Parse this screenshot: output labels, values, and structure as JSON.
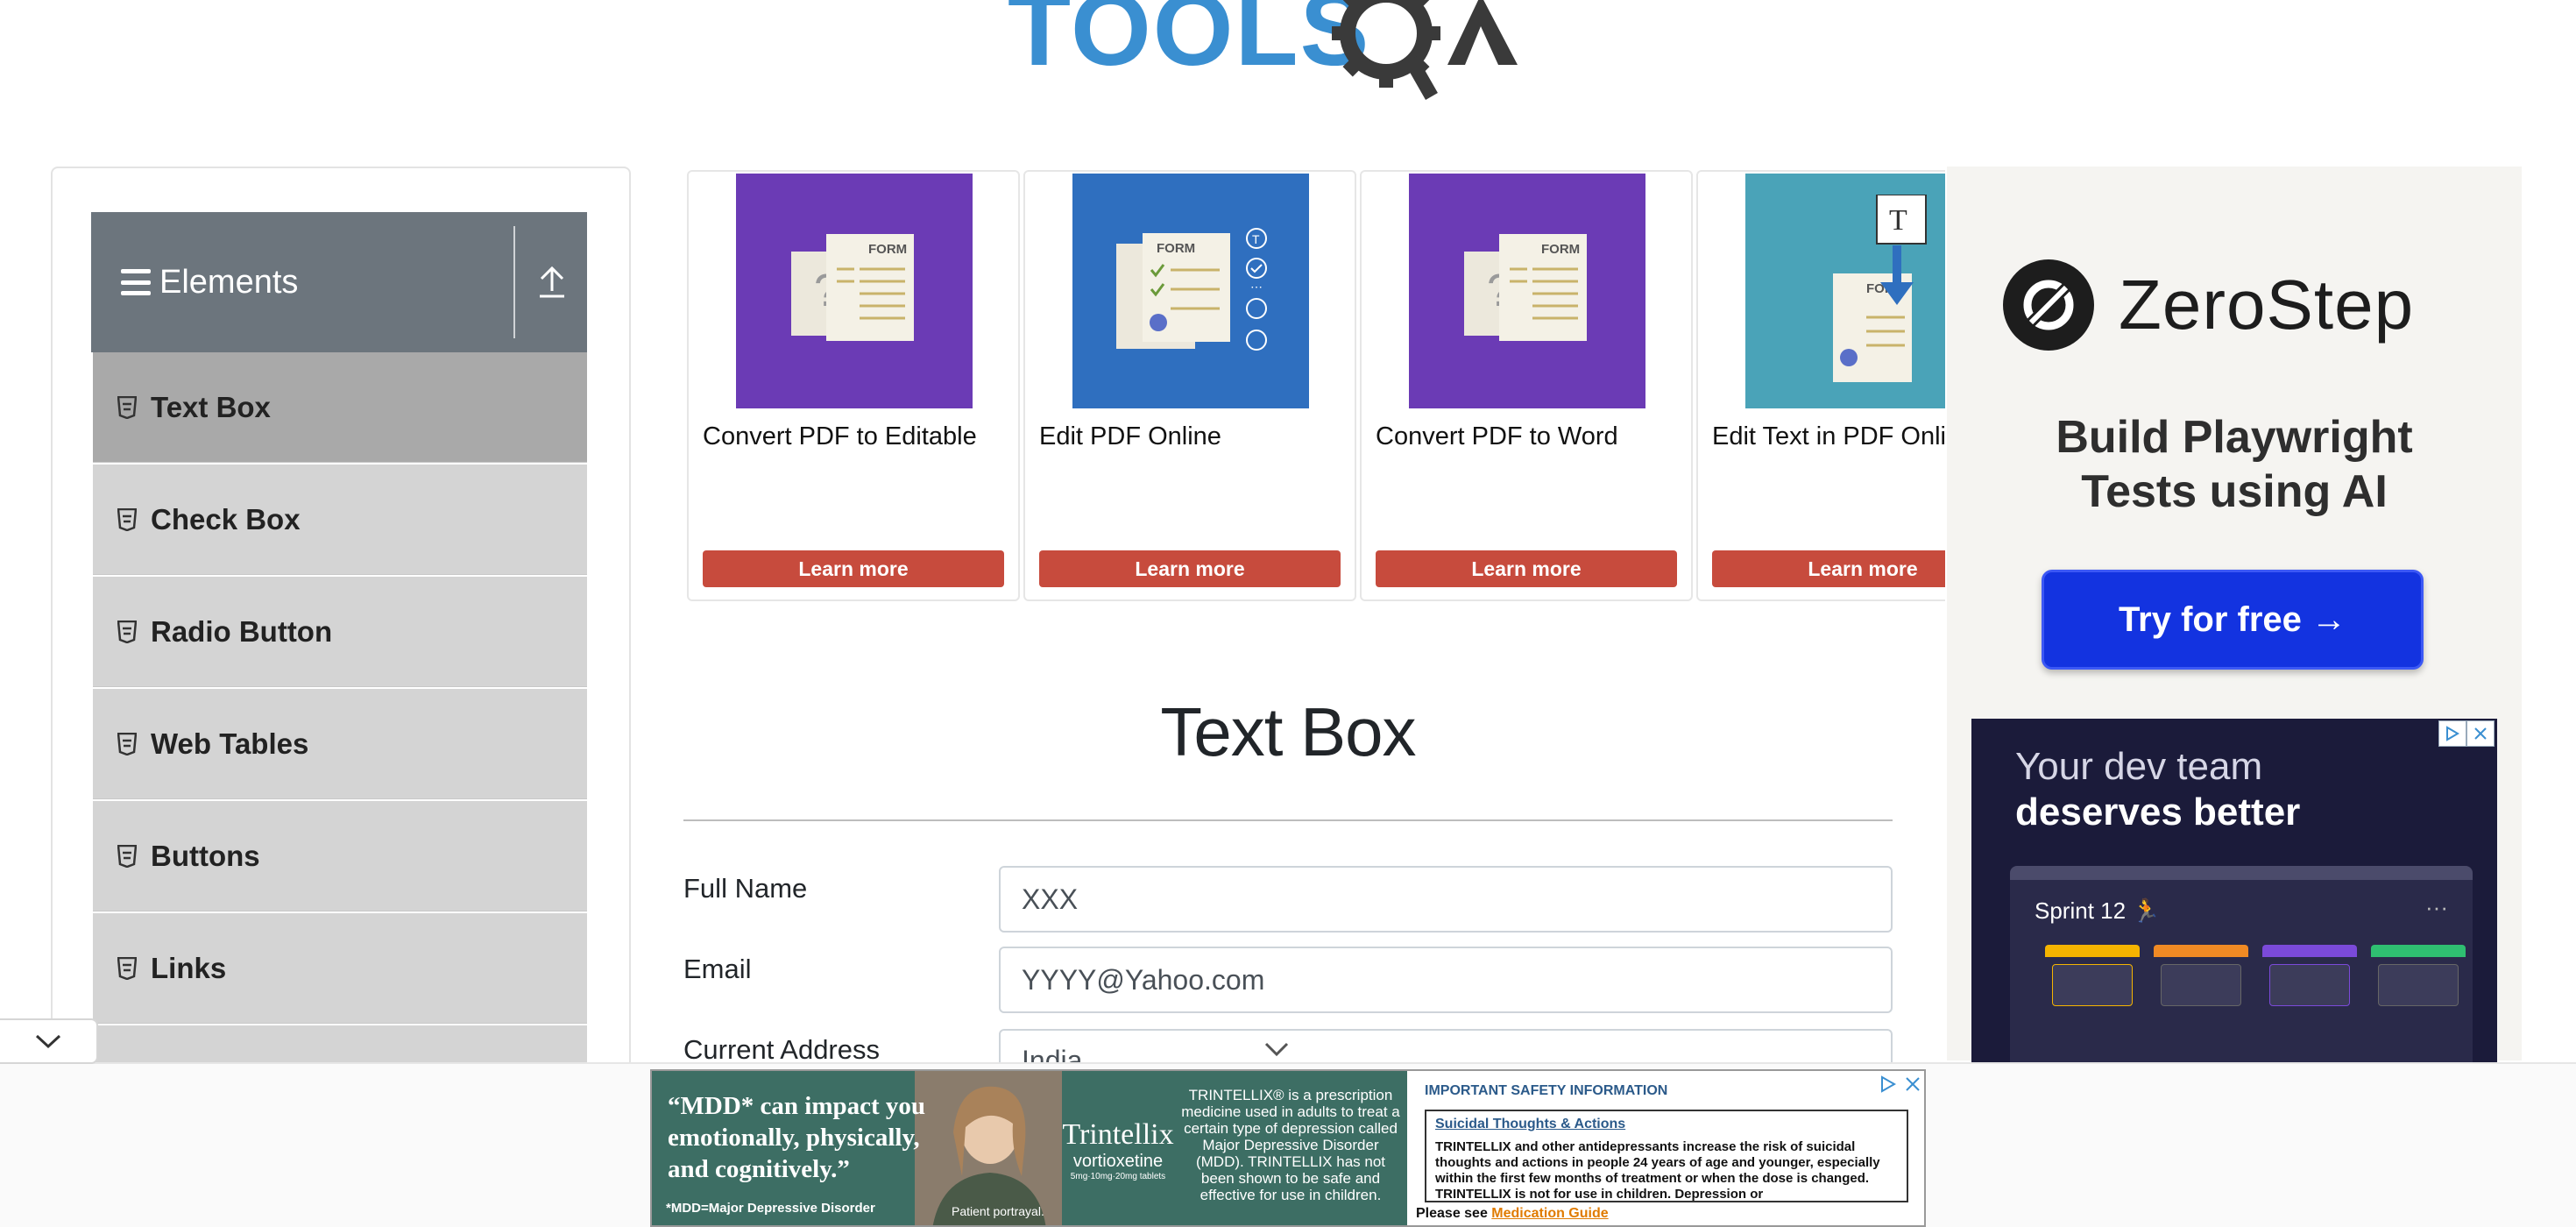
{
  "logo": {
    "text": "TOOLSQA",
    "primary_color": "#3a8fd1",
    "gear_color": "#3a3a3a"
  },
  "sidebar": {
    "group_title": "Elements",
    "items": [
      {
        "label": "Text Box",
        "active": true
      },
      {
        "label": "Check Box",
        "active": false
      },
      {
        "label": "Radio Button",
        "active": false
      },
      {
        "label": "Web Tables",
        "active": false
      },
      {
        "label": "Buttons",
        "active": false
      },
      {
        "label": "Links",
        "active": false
      }
    ]
  },
  "ad_cards": [
    {
      "title": "Convert PDF to Editable",
      "button": "Learn more",
      "bg": "#6b3bb5",
      "badge": "FORM"
    },
    {
      "title": "Edit PDF Online",
      "button": "Learn more",
      "bg": "#2f6fbf",
      "badge": "FORM"
    },
    {
      "title": "Convert PDF to Word",
      "button": "Learn more",
      "bg": "#6b3bb5",
      "badge": "FORM"
    },
    {
      "title": "Edit Text in PDF Onli",
      "button": "Learn more",
      "bg": "#4aa3b8",
      "badge": "FORM"
    }
  ],
  "main": {
    "title": "Text Box",
    "fields": [
      {
        "label": "Full Name",
        "value": "XXX"
      },
      {
        "label": "Email",
        "value": "YYYY@Yahoo.com"
      },
      {
        "label": "Current Address",
        "value": "India"
      }
    ]
  },
  "right_ad": {
    "brand": "ZeroStep",
    "headline_line1": "Build Playwright",
    "headline_line2": "Tests using AI",
    "cta": "Try for free →",
    "cta_color": "#1333e0"
  },
  "right_ad2": {
    "line1": "Your dev team",
    "line2": "deserves better",
    "board_title": "Sprint 12 🏃",
    "board_menu": "···",
    "columns": [
      "#f5b400",
      "#f08a24",
      "#7b4ad9",
      "#2fbf71"
    ]
  },
  "bottom_ad": {
    "quote_line1": "“MDD* can impact you",
    "quote_line2": "emotionally, physically,",
    "quote_line3": "and cognitively.”",
    "footnote": "*MDD=Major Depressive Disorder",
    "portrait_note": "Patient portrayal.",
    "brand_name": "Trintellix",
    "brand_generic": "vortioxetine",
    "brand_doses": "5mg·10mg·20mg tablets",
    "description": "TRINTELLIX® is a prescription medicine used in adults to treat a certain type of depression called Major Depressive Disorder (MDD). TRINTELLIX has not been shown to be safe and effective for use in children.",
    "isi_title": "IMPORTANT SAFETY INFORMATION",
    "isi_heading": "Suicidal Thoughts & Actions",
    "isi_text": "TRINTELLIX and other antidepressants increase the risk of suicidal thoughts and actions in people 24 years of age and younger, especially within the first few months of treatment or when the dose is changed. TRINTELLIX is not for use in children. Depression or",
    "see_prefix": "Please see ",
    "see_link": "Medication Guide"
  }
}
